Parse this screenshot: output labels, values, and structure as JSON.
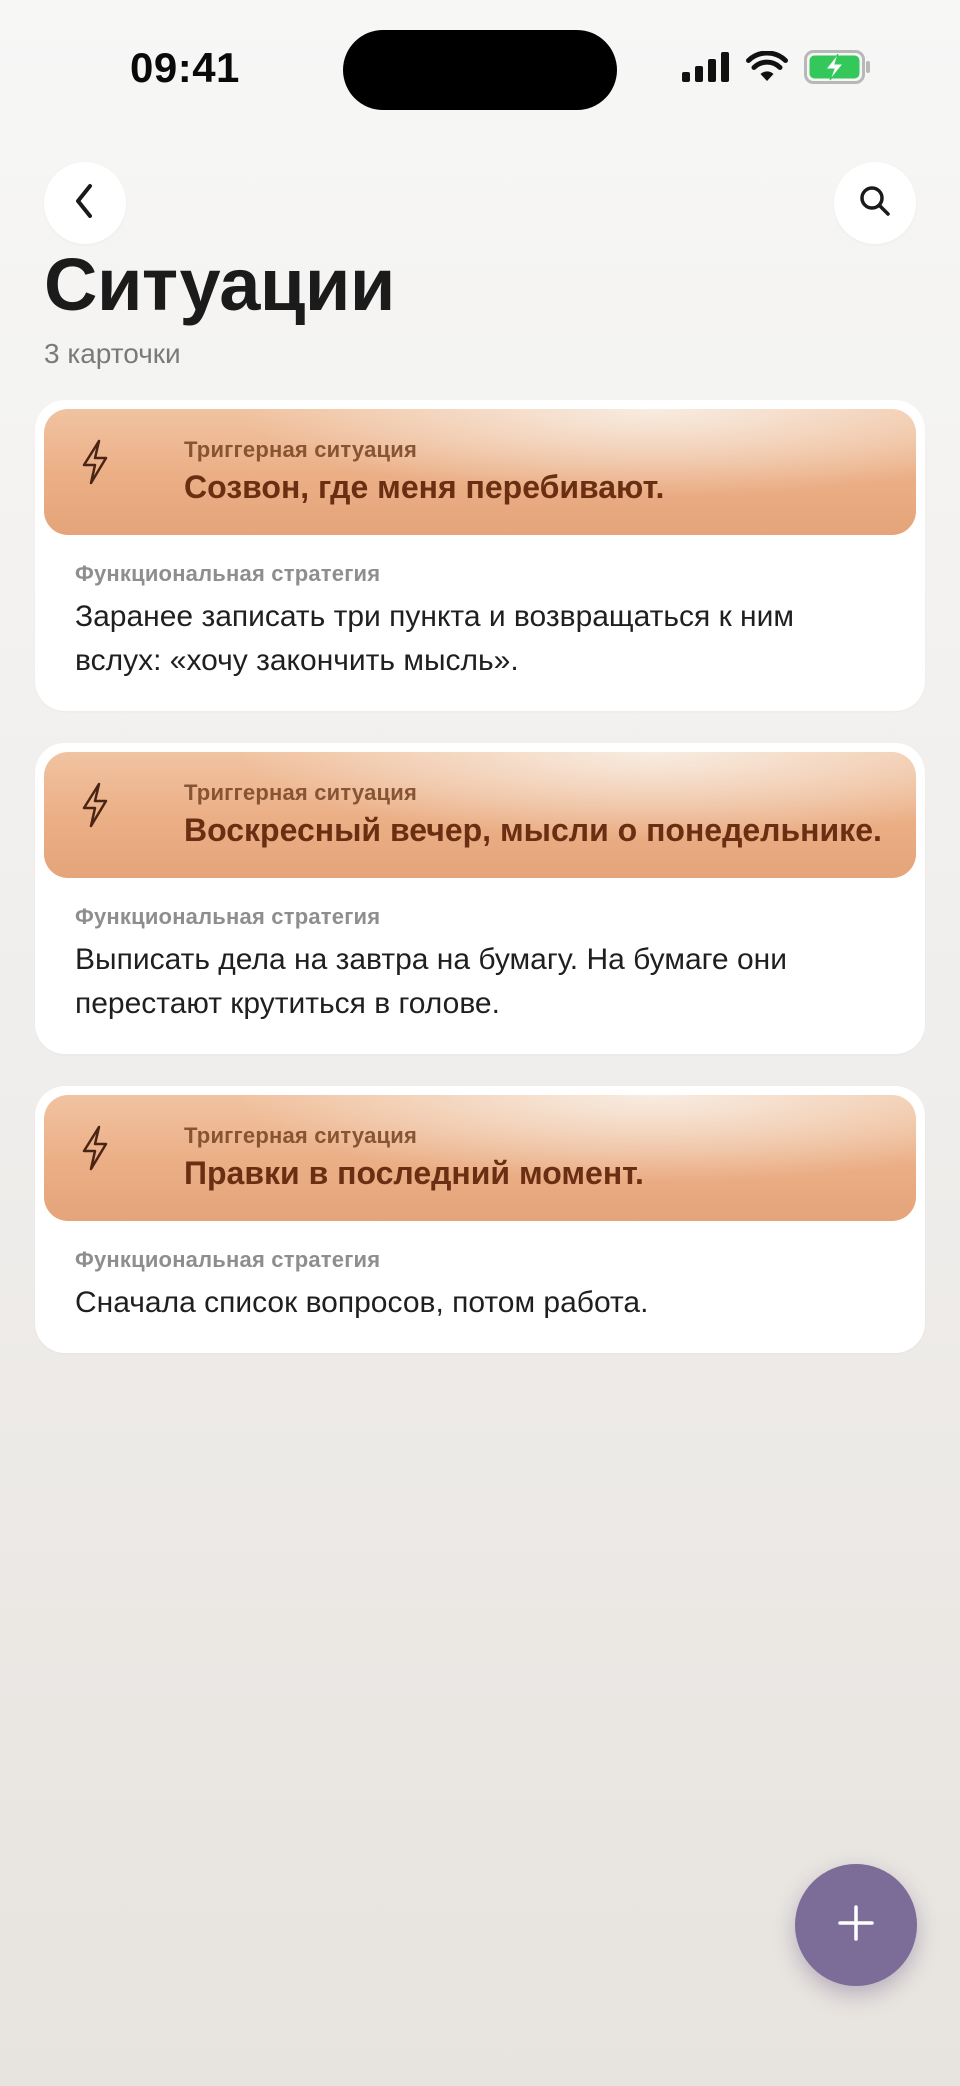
{
  "status_bar": {
    "time": "09:41",
    "icons": [
      "signal-icon",
      "wifi-icon",
      "battery-charging-icon"
    ],
    "battery_color": "#34c759"
  },
  "nav": {
    "back_icon": "chevron-left-icon",
    "search_icon": "search-icon"
  },
  "header": {
    "title": "Ситуации",
    "subtitle": "3 карточки"
  },
  "cards": [
    {
      "trigger_label": "Триггерная ситуация",
      "trigger_text": "Созвон, где меня перебивают.",
      "strategy_label": "Функциональная стратегия",
      "strategy_text": "Заранее записать три пункта и возвращаться к ним вслух: «хочу закончить мысль»."
    },
    {
      "trigger_label": "Триггерная ситуация",
      "trigger_text": "Воскресный вечер, мысли о понедельнике.",
      "strategy_label": "Функциональная стратегия",
      "strategy_text": "Выписать дела на завтра на бумагу. На бумаге они перестают крутиться в голове."
    },
    {
      "trigger_label": "Триггерная ситуация",
      "trigger_text": "Правки в последний момент.",
      "strategy_label": "Функциональная стратегия",
      "strategy_text": "Сначала список вопросов, потом работа."
    }
  ],
  "fab": {
    "icon": "plus-icon",
    "color": "#7b6c98"
  },
  "colors": {
    "trigger_band": "#ebae85",
    "trigger_text": "#6a2e12",
    "card_bg": "#ffffff"
  }
}
